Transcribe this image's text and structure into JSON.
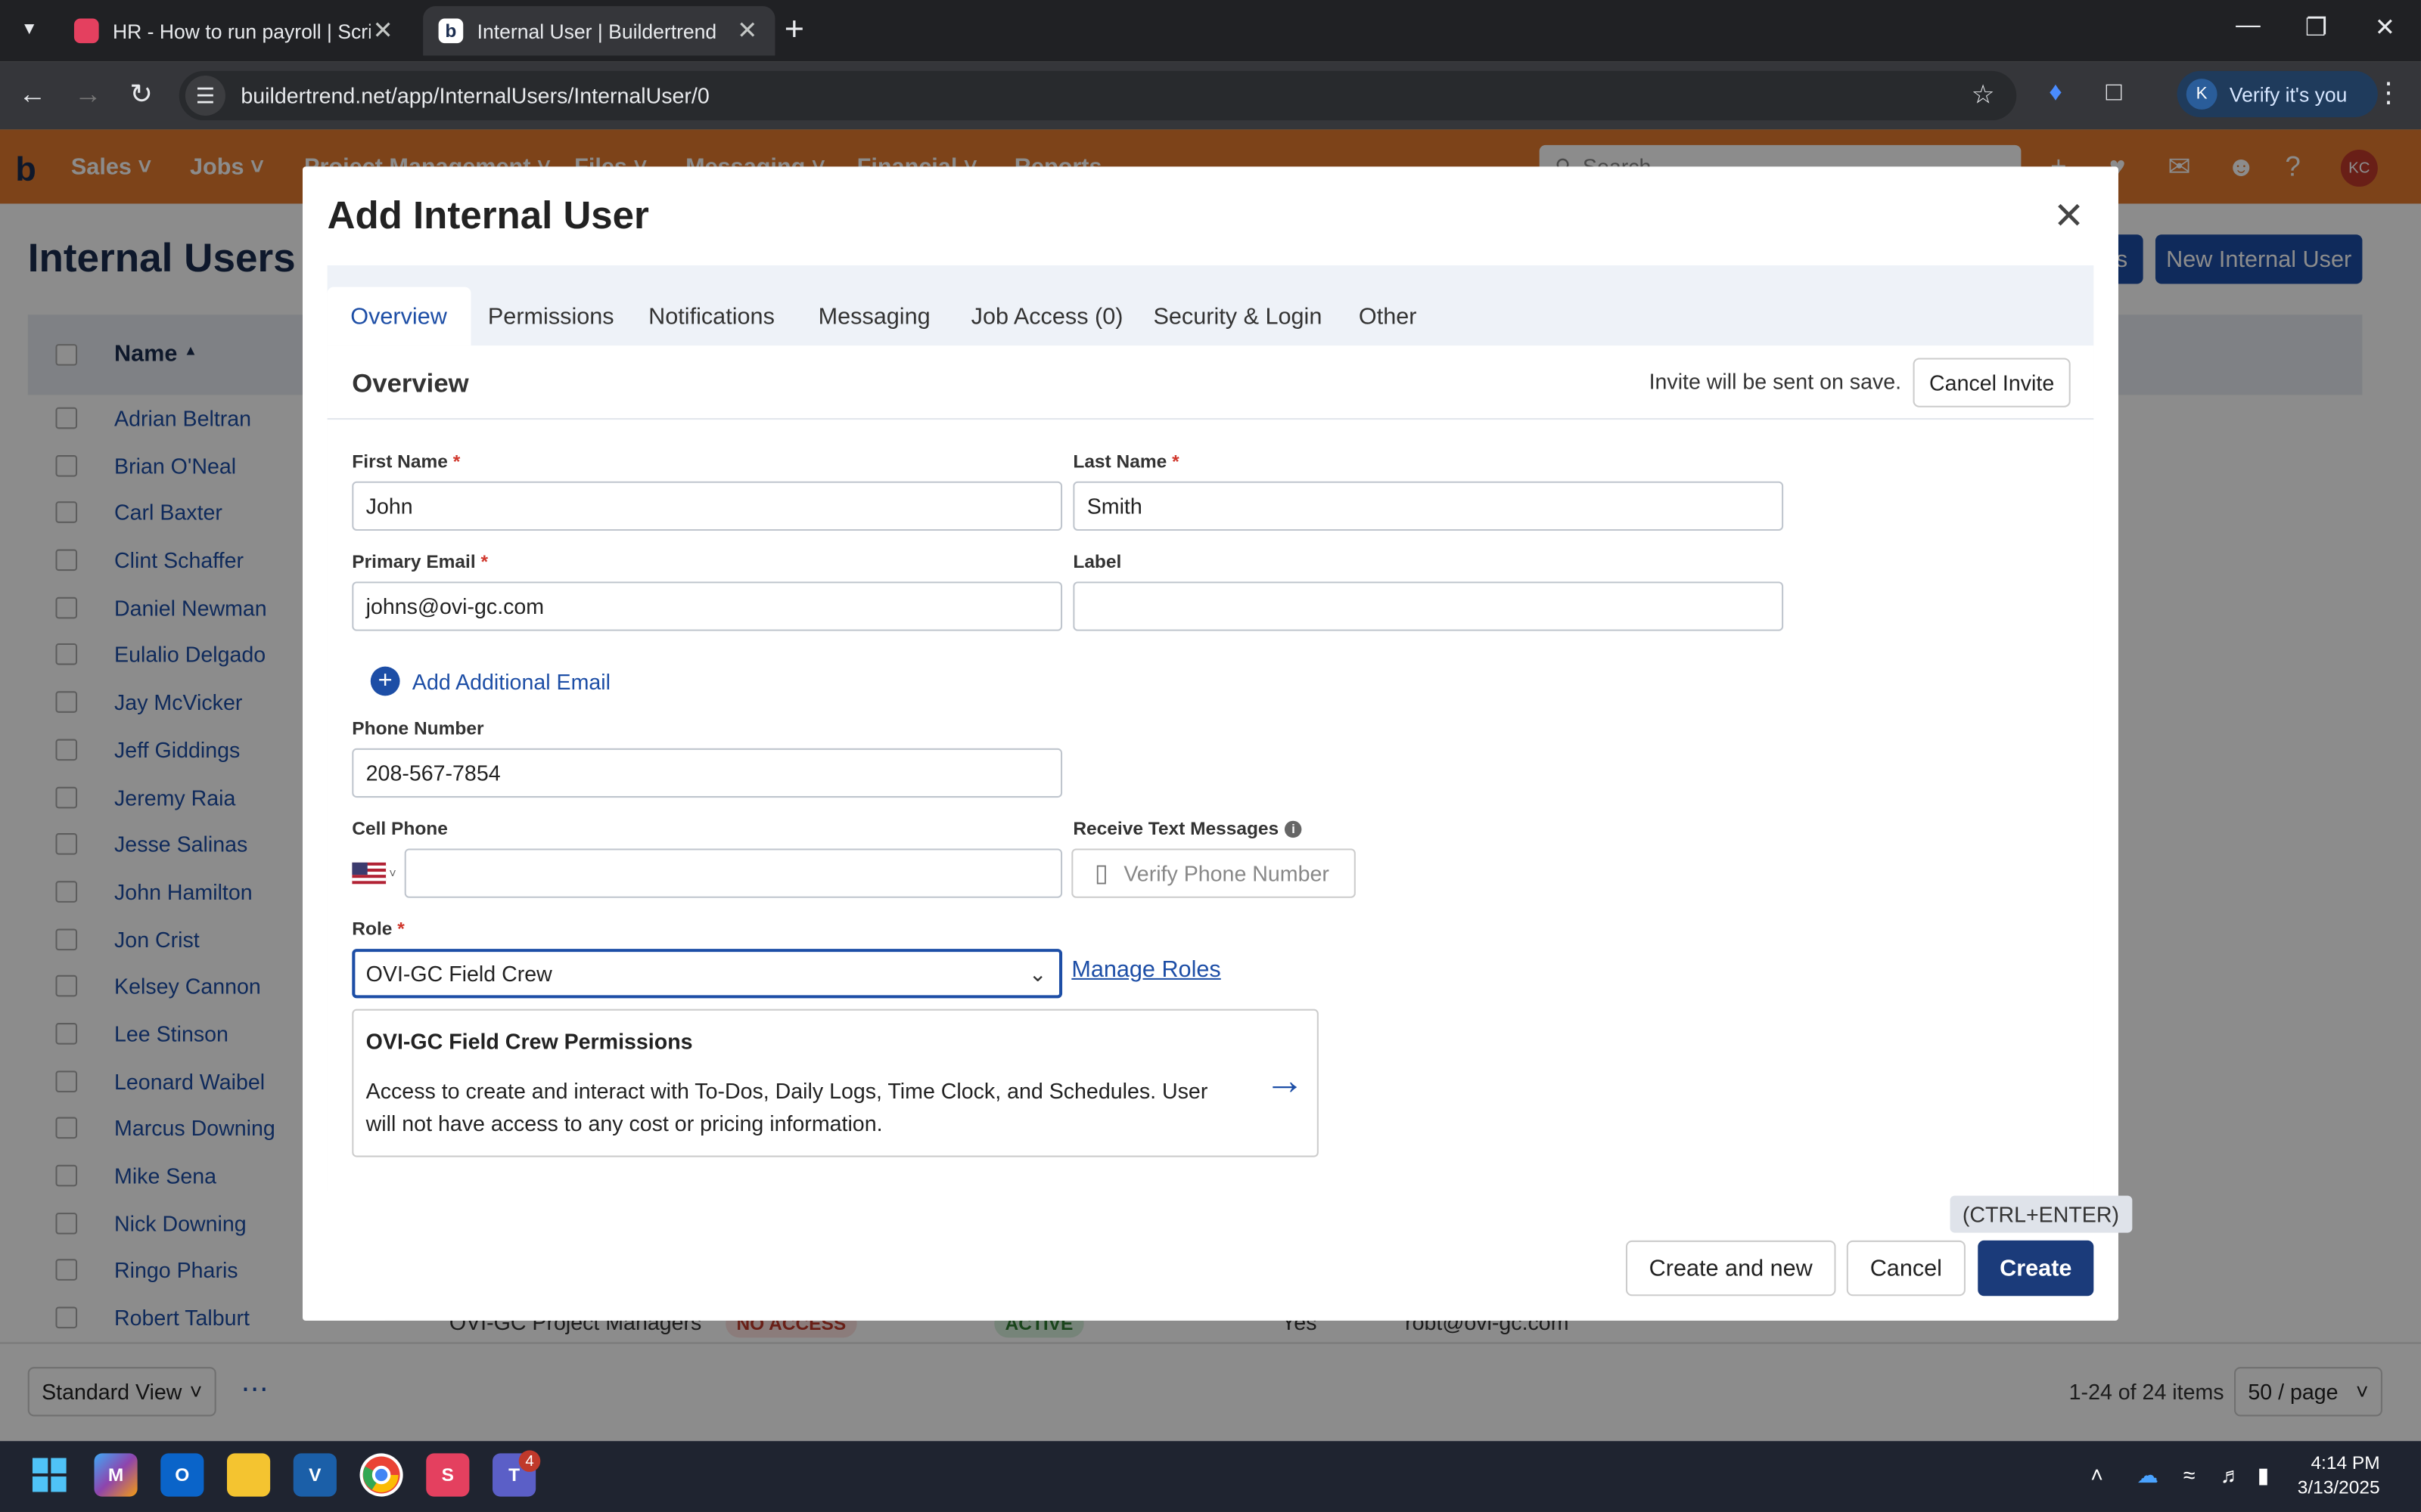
{
  "browser": {
    "tabs": [
      {
        "title": "HR - How to run payroll | Scribe",
        "favicon_color": "#e4405f"
      },
      {
        "title": "Internal User | Buildertrend",
        "favicon_color": "#1b2d4f"
      }
    ],
    "url": "buildertrend.net/app/InternalUsers/InternalUser/0",
    "profile_initial": "K",
    "verify_label": "Verify it's you"
  },
  "app": {
    "logo": "b",
    "nav": [
      "Sales",
      "Jobs",
      "Project Management",
      "Files",
      "Messaging",
      "Financial",
      "Reports"
    ],
    "search_placeholder": "Search",
    "avatar_initials": "KC",
    "accent_color": "#e47a2e"
  },
  "page": {
    "title": "Internal Users",
    "new_button": "New Internal User",
    "hidden_button_suffix": "s",
    "column_name": "Name",
    "users": [
      "Adrian Beltran",
      "Brian O'Neal",
      "Carl Baxter",
      "Clint Schaffer",
      "Daniel Newman",
      "Eulalio Delgado",
      "Jay McVicker",
      "Jeff Giddings",
      "Jeremy Raia",
      "Jesse Salinas",
      "John Hamilton",
      "Jon Crist",
      "Kelsey Cannon",
      "Lee Stinson",
      "Leonard Waibel",
      "Marcus Downing",
      "Mike Sena",
      "Nick Downing",
      "Ringo Pharis",
      "Robert Talburt"
    ],
    "last_row": {
      "role": "OVI-GC Project Managers",
      "access": "NO ACCESS",
      "status": "ACTIVE",
      "flag": "Yes",
      "email": "robt@ovi-gc.com"
    },
    "view": "Standard View",
    "page_count": "1-24 of 24 items",
    "per_page": "50 / page"
  },
  "modal": {
    "title": "Add Internal User",
    "tabs": [
      "Overview",
      "Permissions",
      "Notifications",
      "Messaging",
      "Job Access (0)",
      "Security & Login",
      "Other"
    ],
    "section": "Overview",
    "invite_note": "Invite will be sent on save.",
    "cancel_invite": "Cancel Invite",
    "first_name_label": "First Name",
    "first_name": "John",
    "last_name_label": "Last Name",
    "last_name": "Smith",
    "email_label": "Primary Email",
    "email": "johns@ovi-gc.com",
    "label_label": "Label",
    "label_value": "",
    "add_email": "Add Additional Email",
    "phone_label": "Phone Number",
    "phone": "208-567-7854",
    "cell_label": "Cell Phone",
    "cell": "",
    "text_label": "Receive Text Messages",
    "verify_phone": "Verify Phone Number",
    "role_label": "Role",
    "role": "OVI-GC Field Crew",
    "manage_roles": "Manage Roles",
    "perm_title": "OVI-GC Field Crew Permissions",
    "perm_desc": "Access to create and interact with To-Dos, Daily Logs, Time Clock, and Schedules. User will not have access to any cost or pricing information.",
    "shortcut": "(CTRL+ENTER)",
    "btn_create_new": "Create and new",
    "btn_cancel": "Cancel",
    "btn_create": "Create"
  },
  "taskbar": {
    "teams_badge": "4",
    "time": "4:14 PM",
    "date": "3/13/2025"
  }
}
